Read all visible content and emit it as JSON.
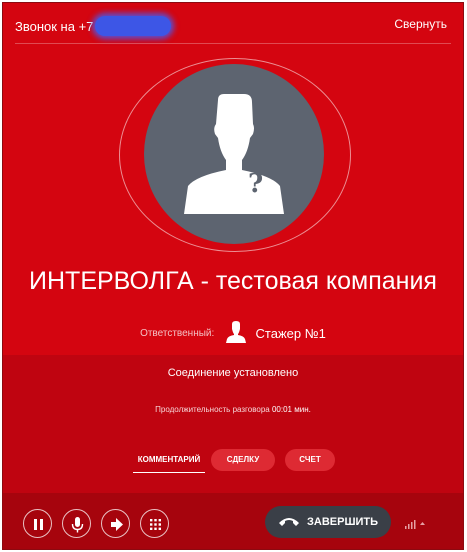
{
  "header": {
    "call_label": "Звонок на +7",
    "collapse_label": "Свернуть"
  },
  "avatar": {
    "placeholder_symbol": "?"
  },
  "company": {
    "name": "ИНТЕРВОЛГА - тестовая компания"
  },
  "responsible": {
    "label": "Ответственный:",
    "name": "Стажер №1"
  },
  "status": {
    "connection": "Соединение установлено",
    "duration_label": "Продолжительность разговора",
    "duration_value": "00:01 мин."
  },
  "tabs": [
    {
      "label": "КОММЕНТАРИЙ"
    },
    {
      "label": "СДЕЛКУ"
    },
    {
      "label": "СЧЕТ"
    }
  ],
  "controls": {
    "pause": "pause-icon",
    "microphone": "microphone-icon",
    "transfer": "transfer-icon",
    "keypad": "keypad-icon"
  },
  "end_call": {
    "label": "ЗАВЕРШИТЬ"
  },
  "colors": {
    "background": "#d40510",
    "status_area": "#bf0410",
    "footer": "#a6040d",
    "avatar": "#5d6470",
    "end_button": "#3a3f47"
  }
}
